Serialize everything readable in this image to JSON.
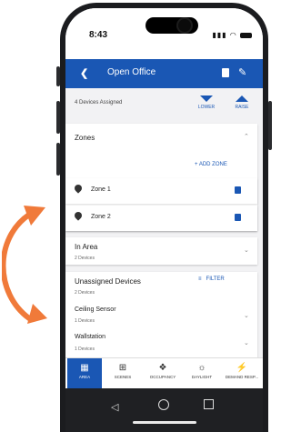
{
  "status": {
    "time": "8:43",
    "signal_icons": "signal-wifi-battery"
  },
  "appbar": {
    "back_icon": "chevron-left-icon",
    "title": "Open Office",
    "delete_icon": "trash-icon",
    "edit_icon": "pencil-icon"
  },
  "devices_bar": {
    "text": "4 Devices Assigned",
    "lower_label": "LOWER",
    "raise_label": "RAISE"
  },
  "zones": {
    "title": "Zones",
    "add_label": "+  ADD ZONE",
    "items": [
      {
        "label": "Zone 1"
      },
      {
        "label": "Zone 2"
      }
    ]
  },
  "in_area": {
    "title": "In Area",
    "count": "2 Devices"
  },
  "unassigned": {
    "title": "Unassigned Devices",
    "count": "2 Devices",
    "filter_label": "FILTER",
    "items": [
      {
        "label": "Ceiling Sensor",
        "count": "1 Devices"
      },
      {
        "label": "Wallstation",
        "count": "1 Devices"
      }
    ]
  },
  "tabs": [
    {
      "label": "AREA",
      "icon": "grid-icon",
      "active": true
    },
    {
      "label": "SCENES",
      "icon": "sliders-icon",
      "active": false
    },
    {
      "label": "OCCUPANCY",
      "icon": "person-icon",
      "active": false
    },
    {
      "label": "DAYLIGHT",
      "icon": "sun-icon",
      "active": false
    },
    {
      "label": "DEMAND RESP...",
      "icon": "bolt-icon",
      "active": false
    }
  ],
  "colors": {
    "primary": "#1a57b4",
    "arrow": "#f07a3a"
  }
}
